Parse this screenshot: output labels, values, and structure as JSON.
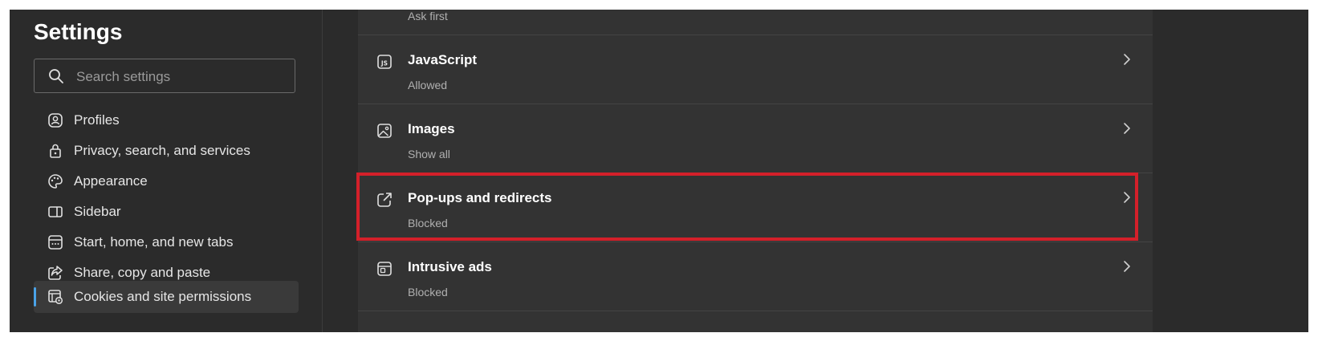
{
  "sidebar": {
    "title": "Settings",
    "search": {
      "placeholder": "Search settings",
      "value": ""
    },
    "items": [
      {
        "label": "Profiles",
        "icon": "profiles-icon",
        "active": false
      },
      {
        "label": "Privacy, search, and services",
        "icon": "lock-icon",
        "active": false
      },
      {
        "label": "Appearance",
        "icon": "palette-icon",
        "active": false
      },
      {
        "label": "Sidebar",
        "icon": "sidebar-icon",
        "active": false
      },
      {
        "label": "Start, home, and new tabs",
        "icon": "home-tab-icon",
        "active": false
      },
      {
        "label": "Share, copy and paste",
        "icon": "share-icon",
        "active": false
      },
      {
        "label": "Cookies and site permissions",
        "icon": "cookies-permissions-icon",
        "active": true
      }
    ]
  },
  "permissions": {
    "partial_row": {
      "status": "Ask first"
    },
    "rows": [
      {
        "title": "JavaScript",
        "status": "Allowed",
        "icon": "javascript-icon"
      },
      {
        "title": "Images",
        "status": "Show all",
        "icon": "image-icon"
      },
      {
        "title": "Pop-ups and redirects",
        "status": "Blocked",
        "icon": "popup-redirect-icon",
        "highlighted": true
      },
      {
        "title": "Intrusive ads",
        "status": "Blocked",
        "icon": "intrusive-ads-icon"
      }
    ]
  },
  "colors": {
    "background": "#2b2b2b",
    "card": "#333333",
    "highlight_border": "#d4202a",
    "active_indicator": "#4aa3e8"
  }
}
